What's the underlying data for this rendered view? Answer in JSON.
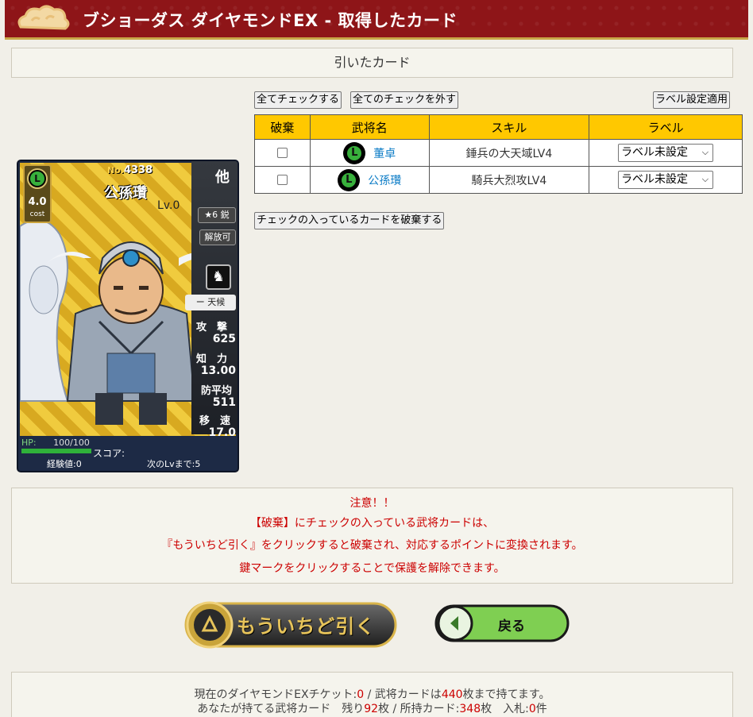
{
  "header": {
    "title": "ブショーダス ダイヤモンドEX - 取得したカード"
  },
  "section_title": "引いたカード",
  "toolbar": {
    "check_all": "全てチェックする",
    "uncheck_all": "全てのチェックを外す",
    "apply_label": "ラベル設定適用"
  },
  "table": {
    "headers": [
      "破棄",
      "武将名",
      "スキル",
      "ラベル"
    ],
    "rows": [
      {
        "badge": "L",
        "name": "董卓",
        "skill": "錘兵の大天域LV4",
        "label": "ラベル未設定"
      },
      {
        "badge": "L",
        "name": "公孫瓚",
        "skill": "騎兵大烈攻LV4",
        "label": "ラベル未設定"
      }
    ]
  },
  "discard_button": "チェックの入っているカードを破棄する",
  "card": {
    "rarity": "L",
    "cost": "4.0",
    "cost_label": "cost",
    "number_prefix": "No.",
    "number": "4338",
    "name": "公孫瓚",
    "level": "Lv.0",
    "faction": "他",
    "stars": "★6 鋭",
    "release": "解放可",
    "trait": "ー 天候",
    "stat1_label": "攻　撃",
    "stat1_value": "625",
    "stat2_label": "知　力",
    "stat2_value": "13.00",
    "stat3_label": "防平均",
    "stat3_value": "511",
    "stat4_label": "移　速",
    "stat4_value": "17.0",
    "hp_label": "HP:",
    "hp_value": "100/100",
    "score_label": "スコア:",
    "exp_label": "経験値:0",
    "next_label": "次のLvまで:5"
  },
  "notice": {
    "title": "注意！！",
    "line1": "【破棄】にチェックの入っている武将カードは、",
    "line2": "『もういちど引く』をクリックすると破棄され、対応するポイントに変換されます。",
    "line3": "鍵マークをクリックすることで保護を解除できます。"
  },
  "buttons": {
    "draw_again": "もういちど引く",
    "back": "戻る"
  },
  "footer": {
    "line1_a": "現在のダイヤモンドEXチケット:",
    "tickets": "0",
    "line1_b": " / 武将カードは",
    "capacity": "440",
    "line1_c": "枚まで持てます。",
    "line2_a": "あなたが持てる武将カード　残り",
    "remaining": "92",
    "line2_b": "枚 / 所持カード:",
    "owned": "348",
    "line2_c": "枚　入札:",
    "bids": "0",
    "line2_d": "件"
  },
  "colors": {
    "header_bg": "#8e1518",
    "table_header": "#ffc800",
    "notice_red": "#cc0000",
    "link_blue": "#0a7bc6",
    "badge_green": "#38b03c"
  }
}
